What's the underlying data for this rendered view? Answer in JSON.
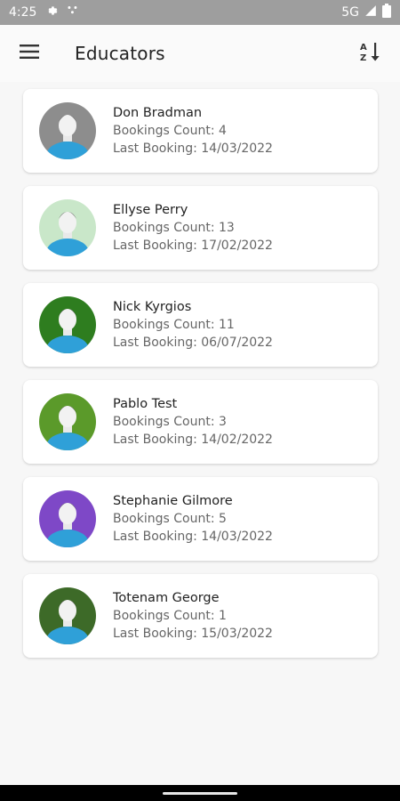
{
  "status_bar": {
    "time": "4:25",
    "network": "5G",
    "icons": [
      "settings-icon",
      "cast-icon",
      "signal-icon",
      "battery-icon"
    ]
  },
  "app_bar": {
    "title": "Educators",
    "menu_icon": "hamburger-menu-icon",
    "sort_icon": "sort-az-icon"
  },
  "colors": {
    "avatar_backgrounds": [
      "#8d8d8d",
      "#c9e7c9",
      "#2e7d1f",
      "#5b9a2a",
      "#7e48c7",
      "#3d6a28"
    ],
    "avatar_body": "#2fa0d8"
  },
  "educators": [
    {
      "name": "Don Bradman",
      "bookings": "Bookings Count: 4",
      "last": "Last Booking: 14/03/2022"
    },
    {
      "name": "Ellyse Perry",
      "bookings": "Bookings Count: 13",
      "last": "Last Booking: 17/02/2022"
    },
    {
      "name": "Nick Kyrgios",
      "bookings": "Bookings Count: 11",
      "last": "Last Booking: 06/07/2022"
    },
    {
      "name": "Pablo Test",
      "bookings": "Bookings Count: 3",
      "last": "Last Booking: 14/02/2022"
    },
    {
      "name": "Stephanie Gilmore",
      "bookings": "Bookings Count: 5",
      "last": "Last Booking: 14/03/2022"
    },
    {
      "name": "Totenam George",
      "bookings": "Bookings Count: 1",
      "last": "Last Booking: 15/03/2022"
    }
  ]
}
